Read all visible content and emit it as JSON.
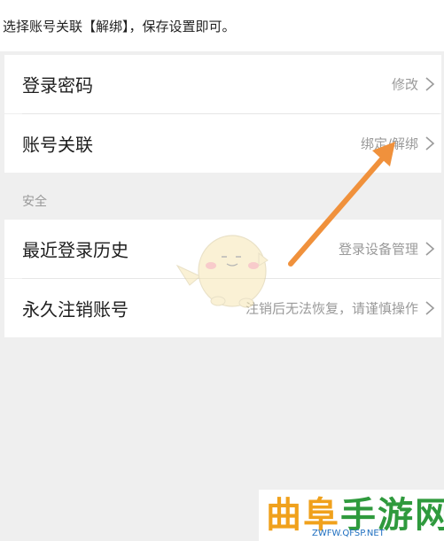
{
  "caption": "选择账号关联【解绑】，保存设置即可。",
  "rows_top": [
    {
      "label": "登录密码",
      "value": "修改"
    },
    {
      "label": "账号关联",
      "value": "绑定/解绑"
    }
  ],
  "section": {
    "label": "安全"
  },
  "rows_security": [
    {
      "label": "最近登录历史",
      "value": "登录设备管理"
    },
    {
      "label": "永久注销账号",
      "value": "注销后无法恢复，请谨慎操作"
    }
  ],
  "watermark": {
    "logo_a": "曲阜",
    "logo_b": "手游网",
    "sub": "ZWFW.QFSP.NET"
  },
  "colors": {
    "panel": "#efefef",
    "arrow": "#f0913c",
    "secondary_text": "#9a9a9a"
  }
}
